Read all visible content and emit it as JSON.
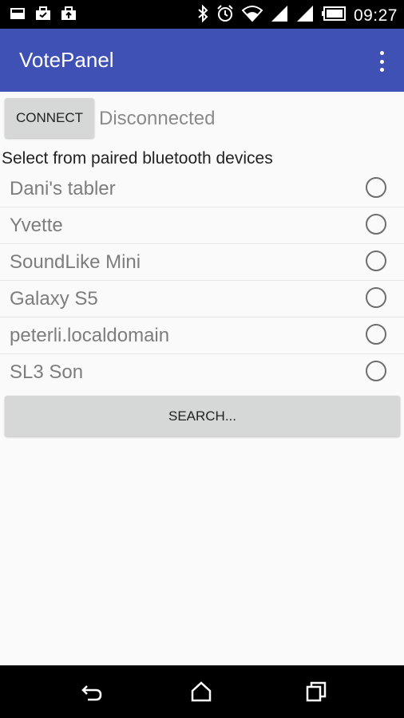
{
  "status_bar": {
    "time": "09:27",
    "left_icons": [
      "image-notification-icon",
      "briefcase-notification-icon",
      "upload-notification-icon"
    ],
    "right_icons": [
      "bluetooth-icon",
      "alarm-icon",
      "wifi-icon",
      "signal-icon",
      "signal-icon-2",
      "battery-icon"
    ]
  },
  "app_bar": {
    "title": "VotePanel",
    "background": "#3f51b5"
  },
  "connection": {
    "connect_label": "CONNECT",
    "status": "Disconnected"
  },
  "devices": {
    "heading": "Select from paired bluetooth devices",
    "items": [
      {
        "name": "Dani's tabler"
      },
      {
        "name": "Yvette"
      },
      {
        "name": "SoundLike Mini"
      },
      {
        "name": "Galaxy S5"
      },
      {
        "name": "peterli.localdomain"
      },
      {
        "name": "SL3 Son"
      }
    ]
  },
  "search": {
    "label": "SEARCH..."
  },
  "nav_bar": {
    "buttons": [
      "back-icon",
      "home-icon",
      "recents-icon"
    ]
  }
}
